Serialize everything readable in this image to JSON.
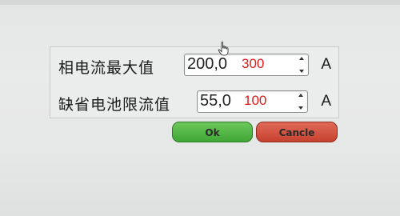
{
  "fields": [
    {
      "label": "相电流最大值",
      "value": "200,0",
      "new_value": "300",
      "unit": "A"
    },
    {
      "label": "缺省电池限流值",
      "value": "55,0",
      "new_value": "100",
      "unit": "A"
    }
  ],
  "buttons": {
    "ok": "Ok",
    "cancel": "Cancle"
  },
  "colors": {
    "annotation": "#e01b1b",
    "ok_button": "#4bb03f",
    "cancel_button": "#d2503e"
  }
}
